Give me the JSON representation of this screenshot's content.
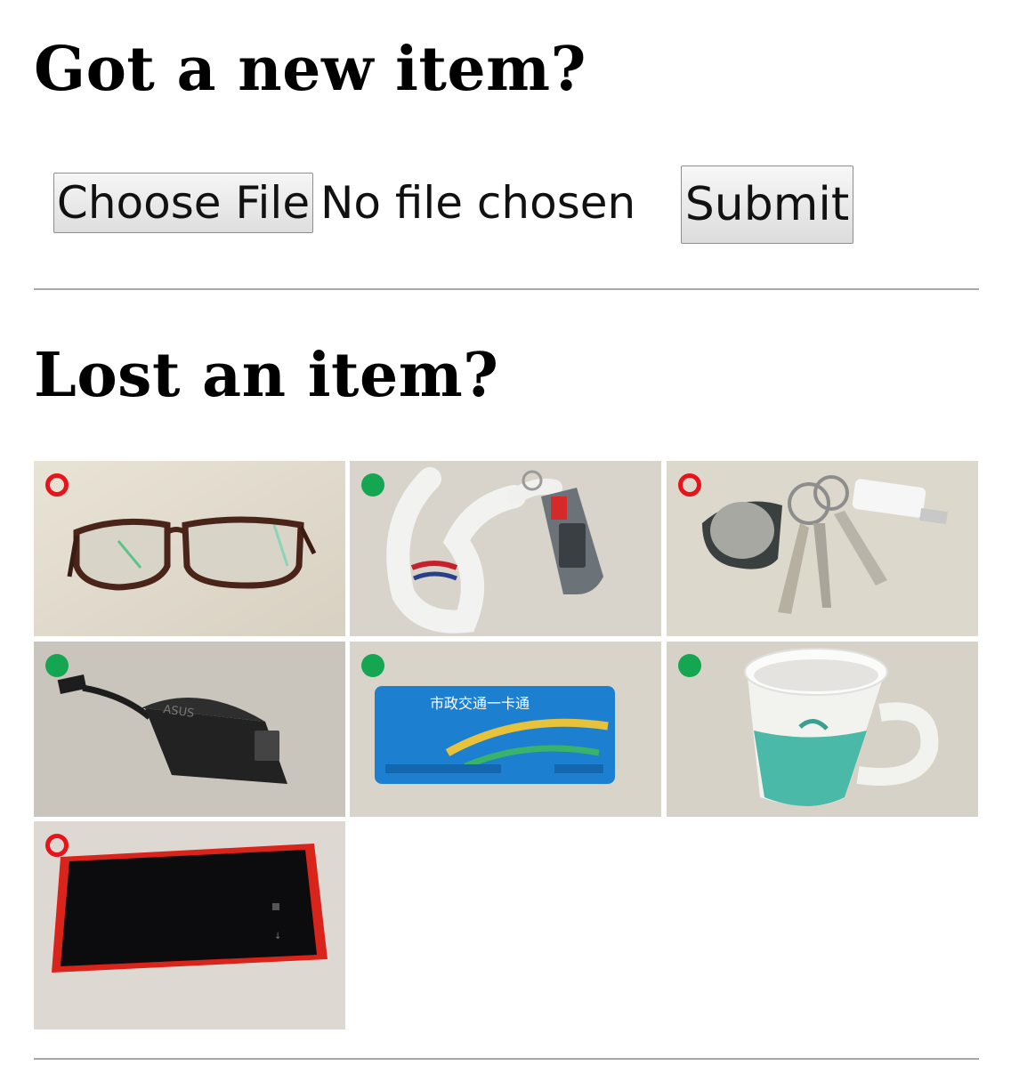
{
  "upload_section": {
    "heading": "Got a new item?",
    "choose_file_label": "Choose File",
    "file_status": "No file chosen",
    "submit_label": "Submit"
  },
  "lost_section": {
    "heading": "Lost an item?",
    "items": [
      {
        "subject": "eyeglasses",
        "status": "unavailable"
      },
      {
        "subject": "lanyard with key fob",
        "status": "available"
      },
      {
        "subject": "key ring with keys",
        "status": "unavailable"
      },
      {
        "subject": "video adapter",
        "status": "available",
        "printed_text": "ASUS"
      },
      {
        "subject": "transit card",
        "status": "available",
        "printed_text": "市政交通一卡通"
      },
      {
        "subject": "mug",
        "status": "available"
      },
      {
        "subject": "smartphone",
        "status": "unavailable"
      }
    ]
  },
  "colors": {
    "available": "#14a650",
    "unavailable": "#e8141c",
    "divider": "#a8a8a8"
  }
}
